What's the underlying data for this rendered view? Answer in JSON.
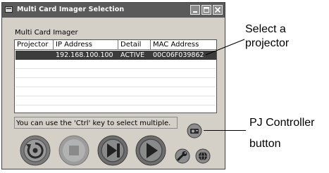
{
  "window": {
    "title": "Multi Card Imager Selection",
    "group_label": "Multi Card Imager"
  },
  "table": {
    "columns": [
      "Projector",
      "IP Address",
      "Detail",
      "MAC Address"
    ],
    "rows": [
      {
        "projector": "",
        "ip": "192.168.100.100",
        "detail": "ACTIVE",
        "mac": "00C06F039862",
        "selected": true
      }
    ]
  },
  "status_text": "You can use the 'Ctrl' key to select multiple.",
  "buttons": [
    {
      "name": "refresh-button",
      "icon": "refresh-icon"
    },
    {
      "name": "stop-button",
      "icon": "stop-icon"
    },
    {
      "name": "next-button",
      "icon": "skip-next-icon"
    },
    {
      "name": "play-button",
      "icon": "play-icon"
    },
    {
      "name": "pj-controller-button",
      "icon": "projector-icon"
    },
    {
      "name": "tools-button",
      "icon": "wrench-icon"
    },
    {
      "name": "help-button",
      "icon": "globe-icon"
    }
  ],
  "callouts": {
    "select_projector": [
      "Select a",
      "projector"
    ],
    "pj_controller": [
      "PJ Controller",
      "button"
    ]
  },
  "colors": {
    "window_bg": "#d4d0c8",
    "titlebar": "#5a5a5a",
    "selected_row": "#3c3c3c"
  }
}
